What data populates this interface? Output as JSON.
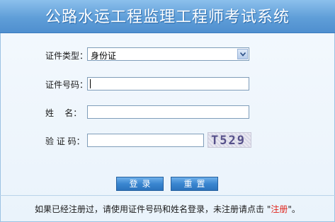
{
  "header": {
    "title": "公路水运工程监理工程师考试系统"
  },
  "form": {
    "id_type_label": "证件类型：",
    "id_type_value": "身份证",
    "id_number_label": "证件号码：",
    "id_number_value": "",
    "name_label": "姓    名：",
    "name_value": "",
    "captcha_label": "验 证 码：",
    "captcha_value": "",
    "captcha_text": "T529"
  },
  "buttons": {
    "login": "登录",
    "reset": "重置"
  },
  "footer": {
    "text_before": "如果已经注册过，请使用证件号码和姓名登录，未注册请点击 \"",
    "register_link": "注册",
    "text_after": "\"。"
  },
  "colors": {
    "title_bar": "#5f9ed8",
    "button": "#3a86d0",
    "link": "#e0241b"
  }
}
